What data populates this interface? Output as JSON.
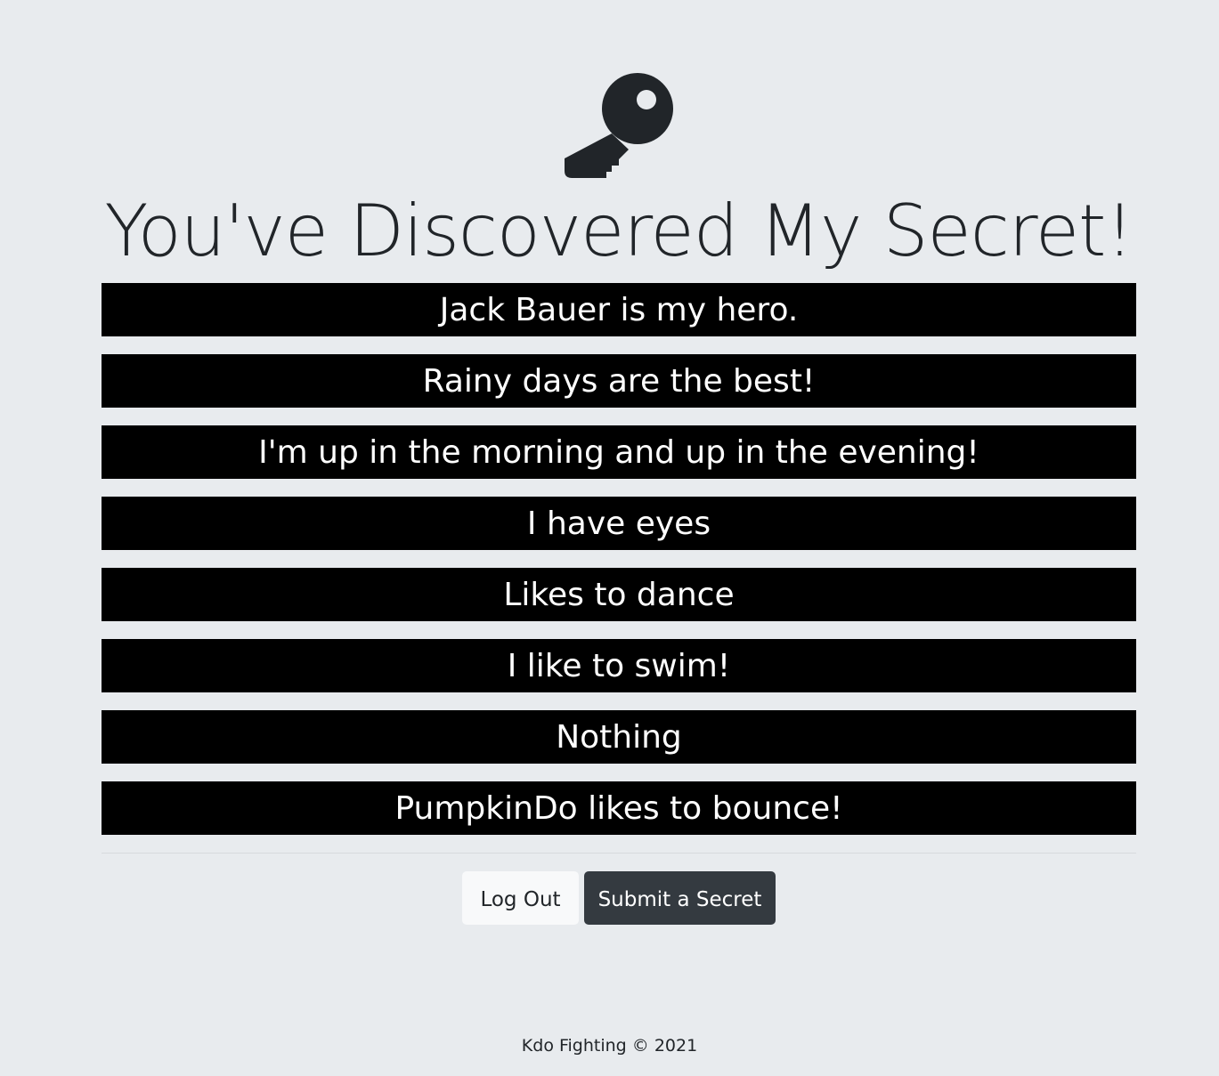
{
  "header": {
    "icon": "key-icon",
    "title": "You've Discovered My Secret!"
  },
  "secrets": [
    "Jack Bauer is my hero.",
    "Rainy days are the best!",
    "I'm up in the morning and up in the evening!",
    "I have eyes",
    "Likes to dance",
    "I like to swim!",
    "Nothing",
    "PumpkinDo likes to bounce!"
  ],
  "actions": {
    "logout_label": "Log Out",
    "submit_label": "Submit a Secret"
  },
  "footer": {
    "text": "Kdo Fighting © 2021"
  },
  "colors": {
    "background": "#e8ebee",
    "secret_bar": "#000000",
    "secret_text": "#ffffff",
    "logout_button": "#f8f9fa",
    "submit_button": "#343a40",
    "text_dark": "#212529"
  }
}
